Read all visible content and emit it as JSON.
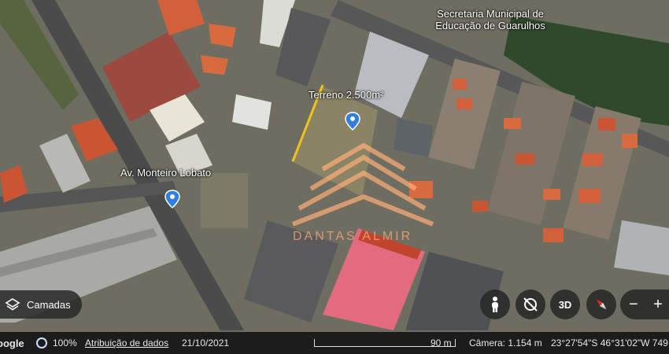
{
  "map": {
    "labels": {
      "poi_line1": "Secretaria Municipal de",
      "poi_line2": "Educação de Guarulhos",
      "lot": "Terreno 2.500m²",
      "street": "Av. Monteiro Lobato"
    },
    "watermark": "DANTAS ALMIR",
    "colors": {
      "lot_outline": "#f2c21b",
      "pin": "#2f7ee0",
      "roof_red": "#c0452c",
      "roof_pink": "#e36b80"
    }
  },
  "controls": {
    "layers_label": "Camadas",
    "layers_icon": "layers-icon",
    "view3d_label": "3D",
    "zoom_out": "−",
    "zoom_in": "+"
  },
  "status_bar": {
    "brand": "oogle",
    "progress": "100%",
    "attribution": "Atribuição de dados",
    "date": "21/10/2021",
    "scale": "90 m",
    "camera": "Câmera: 1.154 m",
    "coords": "23°27'54\"S 46°31'02\"W  749"
  }
}
